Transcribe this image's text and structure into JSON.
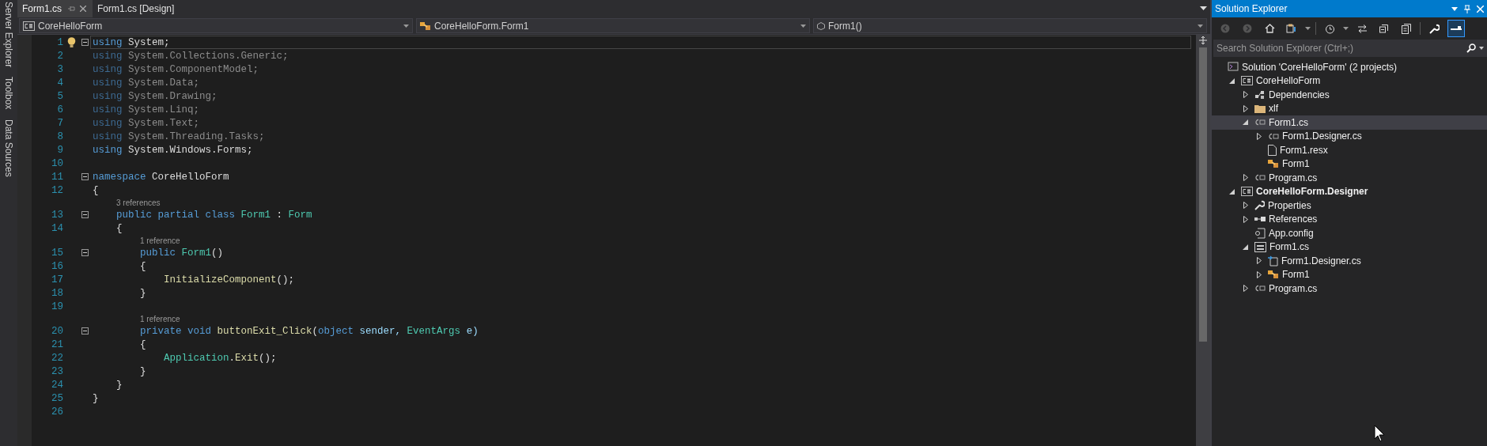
{
  "side_tabs": [
    "Server Explorer",
    "Toolbox",
    "Data Sources"
  ],
  "doc_tabs": [
    {
      "label": "Form1.cs",
      "selected": true
    },
    {
      "label": "Form1.cs [Design]",
      "selected": false
    }
  ],
  "nav_bar": [
    {
      "label": "CoreHelloForm",
      "kind": "project"
    },
    {
      "label": "CoreHelloForm.Form1",
      "kind": "class"
    },
    {
      "label": "Form1()",
      "kind": "method"
    }
  ],
  "code_lines": [
    {
      "number": "1",
      "fold": true,
      "current": true,
      "faded": false,
      "segments": [
        {
          "t": "using",
          "kind": "keyword"
        },
        {
          "t": " System;",
          "kind": "text"
        }
      ]
    },
    {
      "number": "2",
      "fold": false,
      "current": false,
      "faded": true,
      "segments": [
        {
          "t": "using",
          "kind": "keyword"
        },
        {
          "t": " System.Collections.Generic;",
          "kind": "text"
        }
      ]
    },
    {
      "number": "3",
      "fold": false,
      "current": false,
      "faded": true,
      "segments": [
        {
          "t": "using",
          "kind": "keyword"
        },
        {
          "t": " System.ComponentModel;",
          "kind": "text"
        }
      ]
    },
    {
      "number": "4",
      "fold": false,
      "current": false,
      "faded": true,
      "segments": [
        {
          "t": "using",
          "kind": "keyword"
        },
        {
          "t": " System.Data;",
          "kind": "text"
        }
      ]
    },
    {
      "number": "5",
      "fold": false,
      "current": false,
      "faded": true,
      "segments": [
        {
          "t": "using",
          "kind": "keyword"
        },
        {
          "t": " System.Drawing;",
          "kind": "text"
        }
      ]
    },
    {
      "number": "6",
      "fold": false,
      "current": false,
      "faded": true,
      "segments": [
        {
          "t": "using",
          "kind": "keyword"
        },
        {
          "t": " System.Linq;",
          "kind": "text"
        }
      ]
    },
    {
      "number": "7",
      "fold": false,
      "current": false,
      "faded": true,
      "segments": [
        {
          "t": "using",
          "kind": "keyword"
        },
        {
          "t": " System.Text;",
          "kind": "text"
        }
      ]
    },
    {
      "number": "8",
      "fold": false,
      "current": false,
      "faded": true,
      "segments": [
        {
          "t": "using",
          "kind": "keyword"
        },
        {
          "t": " System.Threading.Tasks;",
          "kind": "text"
        }
      ]
    },
    {
      "number": "9",
      "fold": false,
      "current": false,
      "faded": false,
      "segments": [
        {
          "t": "using",
          "kind": "keyword"
        },
        {
          "t": " System.Windows.Forms;",
          "kind": "text"
        }
      ]
    },
    {
      "number": "10",
      "fold": false,
      "current": false
    },
    {
      "number": "11",
      "fold": true,
      "current": false,
      "faded": false,
      "segments": [
        {
          "t": "namespace",
          "kind": "keyword"
        },
        {
          "t": " CoreHelloForm",
          "kind": "text"
        }
      ]
    },
    {
      "number": "12",
      "fold": false,
      "current": false,
      "faded": false,
      "segments": [
        {
          "t": "{",
          "kind": "text"
        }
      ]
    },
    {
      "number": "13",
      "fold": true,
      "current": false,
      "faded": false,
      "lens": "3 references",
      "segments": [
        {
          "t": "    public partial class ",
          "kind": "keyword"
        },
        {
          "t": "Form1",
          "kind": "type"
        },
        {
          "t": " : ",
          "kind": "text"
        },
        {
          "t": "Form",
          "kind": "type"
        }
      ]
    },
    {
      "number": "14",
      "fold": false,
      "current": false,
      "faded": false,
      "segments": [
        {
          "t": "    {",
          "kind": "text"
        }
      ]
    },
    {
      "number": "15",
      "fold": true,
      "current": false,
      "faded": false,
      "lens": "1 reference",
      "segments": [
        {
          "t": "        public ",
          "kind": "keyword"
        },
        {
          "t": "Form1",
          "kind": "type"
        },
        {
          "t": "()",
          "kind": "text"
        }
      ]
    },
    {
      "number": "16",
      "fold": false,
      "current": false,
      "faded": false,
      "segments": [
        {
          "t": "        {",
          "kind": "text"
        }
      ]
    },
    {
      "number": "17",
      "fold": false,
      "current": false,
      "faded": false,
      "segments": [
        {
          "t": "            InitializeComponent",
          "kind": "method"
        },
        {
          "t": "();",
          "kind": "text"
        }
      ]
    },
    {
      "number": "18",
      "fold": false,
      "current": false,
      "faded": false,
      "segments": [
        {
          "t": "        }",
          "kind": "text"
        }
      ]
    },
    {
      "number": "19",
      "fold": false,
      "current": false
    },
    {
      "number": "20",
      "fold": true,
      "current": false,
      "faded": false,
      "lens": "1 reference",
      "segments": [
        {
          "t": "        private void ",
          "kind": "keyword"
        },
        {
          "t": "buttonExit_Click",
          "kind": "method"
        },
        {
          "t": "(",
          "kind": "text"
        },
        {
          "t": "object",
          "kind": "keyword"
        },
        {
          "t": " sender, ",
          "kind": "param"
        },
        {
          "t": "EventArgs",
          "kind": "type"
        },
        {
          "t": " e)",
          "kind": "param"
        }
      ]
    },
    {
      "number": "21",
      "fold": false,
      "current": false,
      "faded": false,
      "segments": [
        {
          "t": "        {",
          "kind": "text"
        }
      ]
    },
    {
      "number": "22",
      "fold": false,
      "current": false,
      "faded": false,
      "segments": [
        {
          "t": "            Application",
          "kind": "type"
        },
        {
          "t": ".",
          "kind": "text"
        },
        {
          "t": "Exit",
          "kind": "method"
        },
        {
          "t": "();",
          "kind": "text"
        }
      ]
    },
    {
      "number": "23",
      "fold": false,
      "current": false,
      "faded": false,
      "segments": [
        {
          "t": "        }",
          "kind": "text"
        }
      ]
    },
    {
      "number": "24",
      "fold": false,
      "current": false,
      "faded": false,
      "segments": [
        {
          "t": "    }",
          "kind": "text"
        }
      ]
    },
    {
      "number": "25",
      "fold": false,
      "current": false,
      "faded": false,
      "segments": [
        {
          "t": "}",
          "kind": "text"
        }
      ]
    },
    {
      "number": "26",
      "fold": false,
      "current": false
    }
  ],
  "solution_explorer": {
    "title": "Solution Explorer",
    "preview_toggle": {
      "on": true
    },
    "search": {
      "placeholder": "Search Solution Explorer (Ctrl+;)"
    },
    "tree": [
      {
        "label": "Solution 'CoreHelloForm' (2 projects)",
        "kind": "solution",
        "selected": false,
        "bold": false,
        "children": [
          {
            "label": "CoreHelloForm",
            "kind": "project",
            "expanded": true,
            "selected": false,
            "bold": false,
            "children": [
              {
                "label": "Dependencies",
                "kind": "dependencies",
                "expanded": false,
                "selected": false,
                "bold": false
              },
              {
                "label": "xlf",
                "kind": "folder",
                "expanded": false,
                "selected": false,
                "bold": false
              },
              {
                "label": "Form1.cs",
                "kind": "cs",
                "expanded": true,
                "selected": true,
                "bold": false,
                "children": [
                  {
                    "label": "Form1.Designer.cs",
                    "kind": "cs",
                    "expanded": false,
                    "selected": false,
                    "bold": false
                  },
                  {
                    "label": "Form1.resx",
                    "kind": "resx",
                    "selected": false,
                    "bold": false
                  },
                  {
                    "label": "Form1",
                    "kind": "class",
                    "selected": false,
                    "bold": false
                  }
                ]
              },
              {
                "label": "Program.cs",
                "kind": "cs",
                "expanded": false,
                "selected": false,
                "bold": false
              }
            ]
          },
          {
            "label": "CoreHelloForm.Designer",
            "kind": "project",
            "expanded": true,
            "selected": false,
            "bold": true,
            "children": [
              {
                "label": "Properties",
                "kind": "wrench",
                "expanded": false,
                "selected": false,
                "bold": false
              },
              {
                "label": "References",
                "kind": "references",
                "expanded": false,
                "selected": false,
                "bold": false
              },
              {
                "label": "App.config",
                "kind": "config",
                "selected": false,
                "bold": false
              },
              {
                "label": "Form1.cs",
                "kind": "form",
                "expanded": true,
                "selected": false,
                "bold": false,
                "children": [
                  {
                    "label": "Form1.Designer.cs",
                    "kind": "designer",
                    "expanded": false,
                    "selected": false,
                    "bold": false
                  },
                  {
                    "label": "Form1",
                    "kind": "class",
                    "expanded": false,
                    "selected": false,
                    "bold": false
                  }
                ]
              },
              {
                "label": "Program.cs",
                "kind": "cs",
                "expanded": false,
                "selected": false,
                "bold": false
              }
            ]
          }
        ]
      }
    ]
  }
}
